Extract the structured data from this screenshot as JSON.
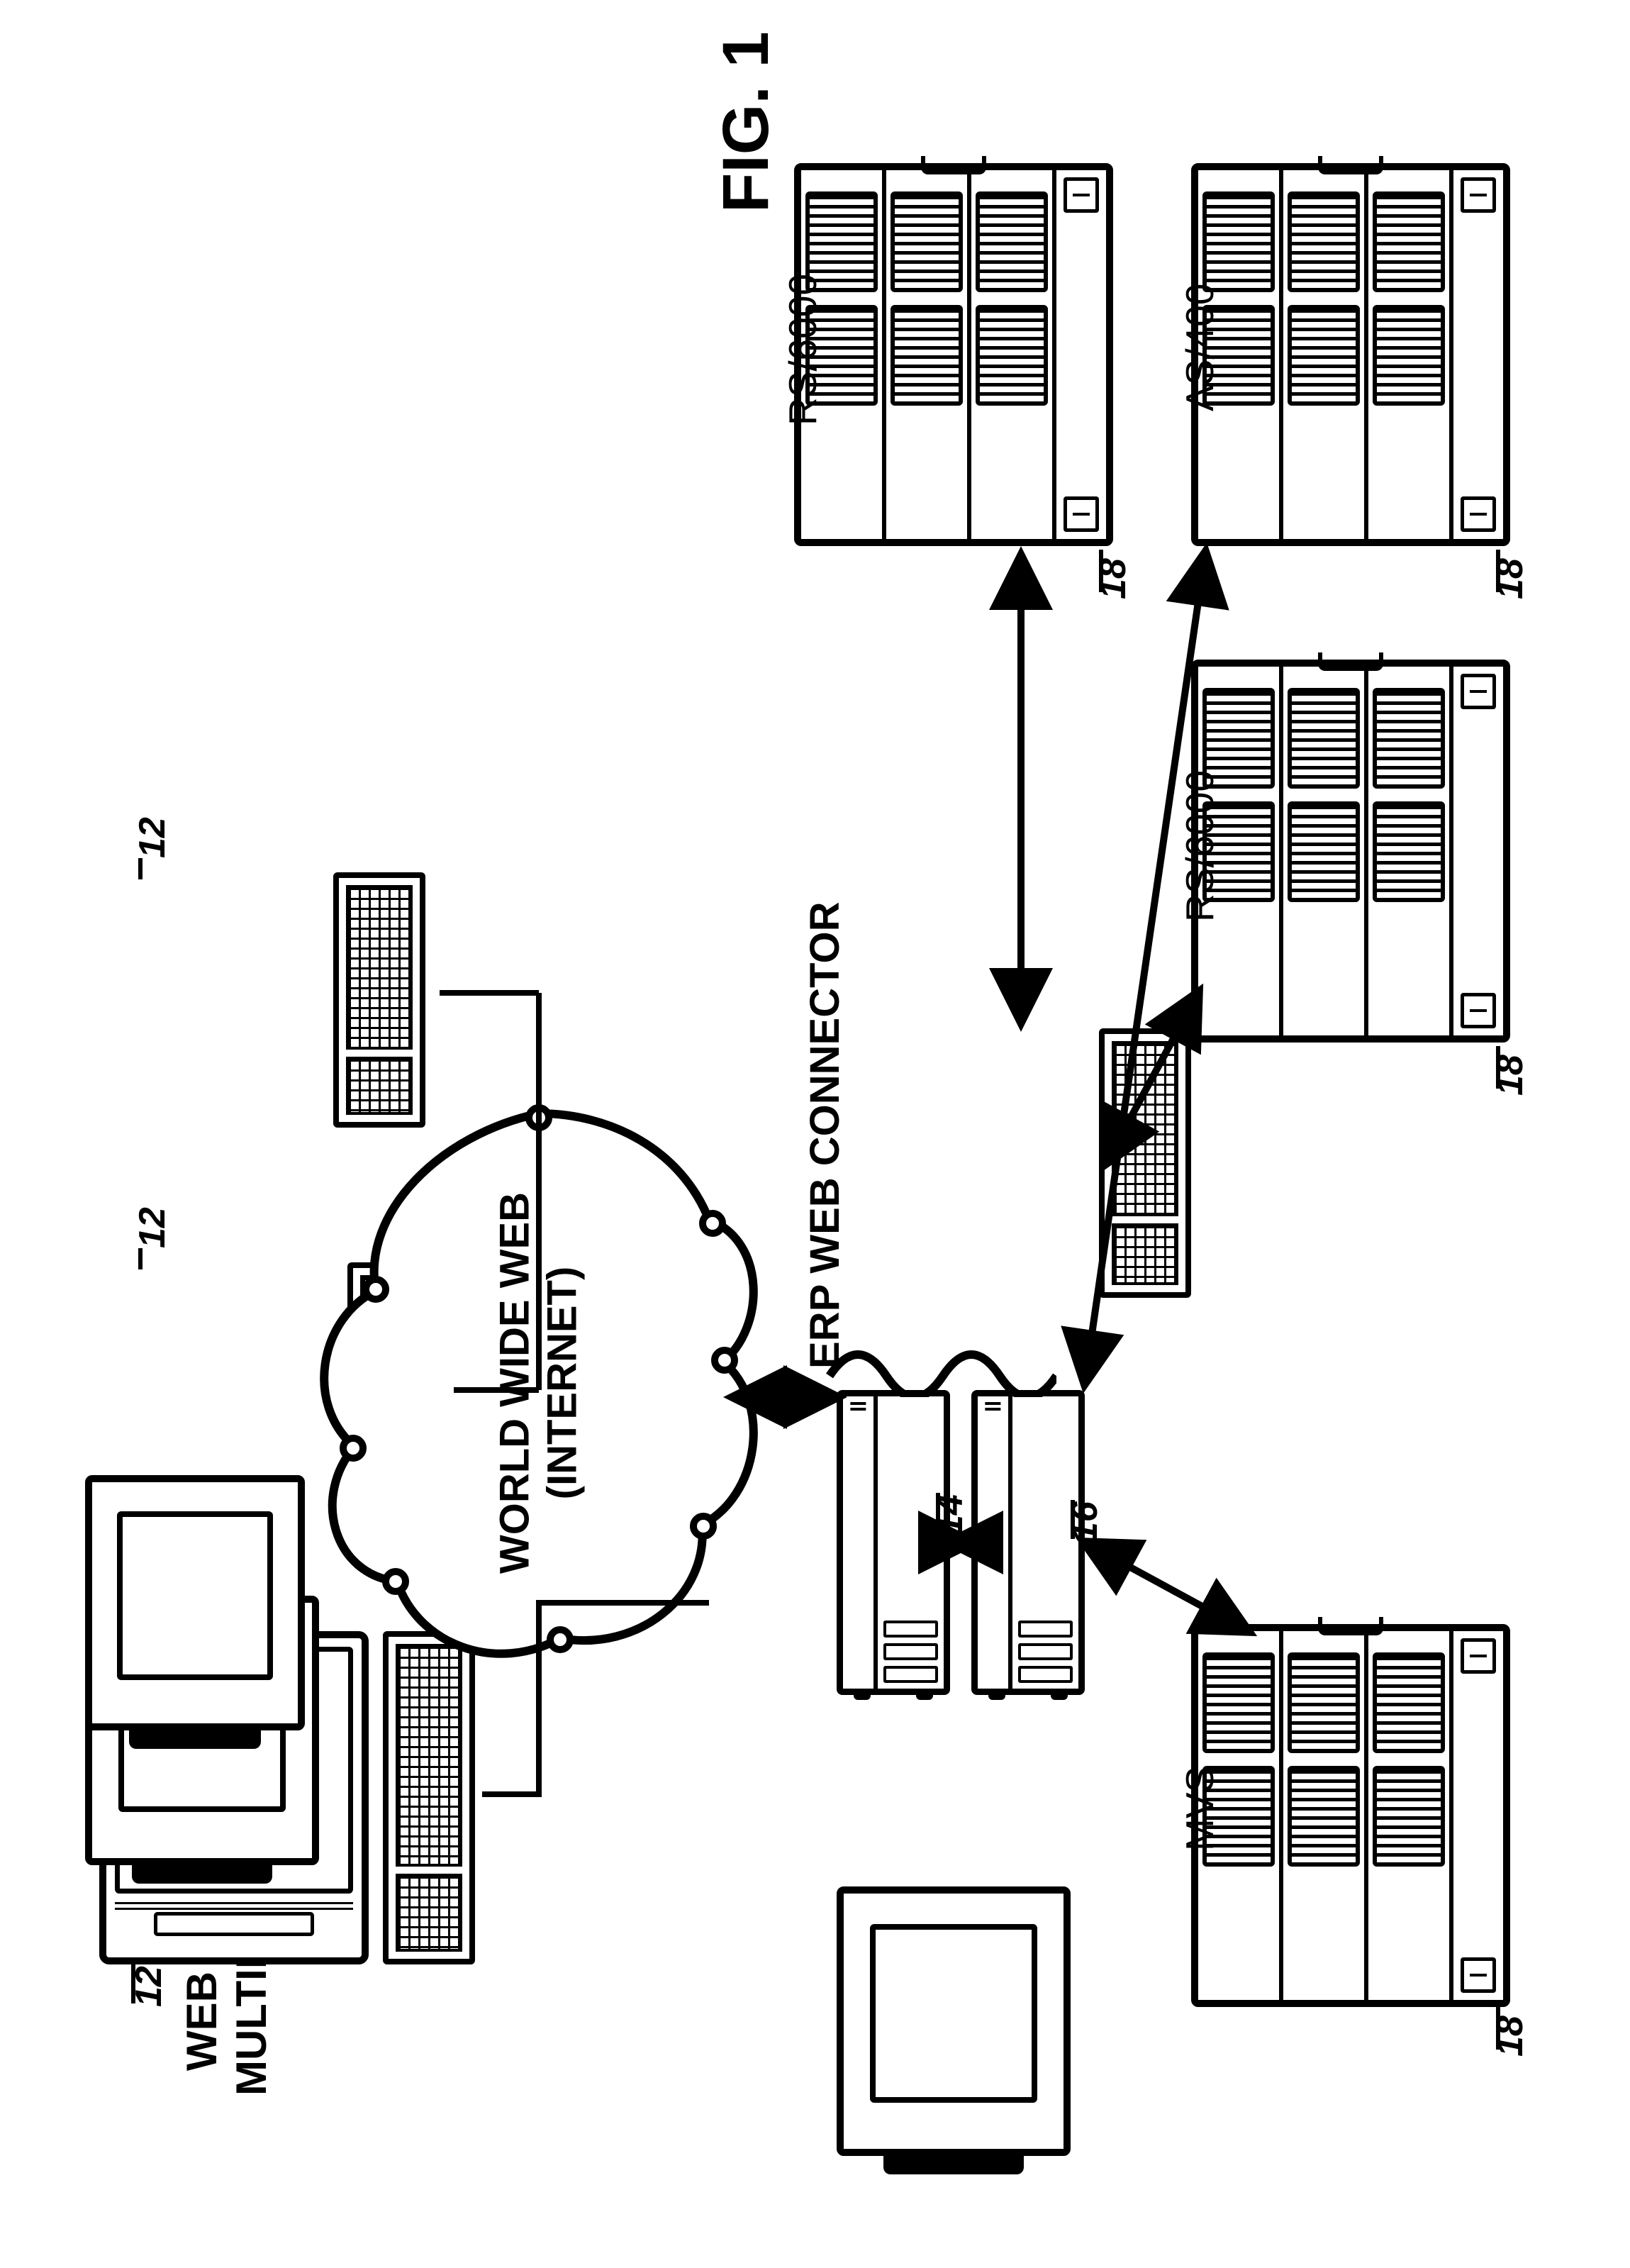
{
  "figure_title": "FIG. 1",
  "labels": {
    "browsers_heading_l1": "WEB BROWSERS ON",
    "browsers_heading_l2": "MULTIPLE PLATFORMS",
    "cloud_l1": "WORLD WIDE WEB",
    "cloud_l2": "(INTERNET)",
    "erp": "ERP WEB CONNECTOR",
    "server_mvs": "MVS",
    "server_as400": "AS/400",
    "server_rs6000_a": "RS/6000",
    "server_rs6000_b": "RS/6000"
  },
  "refs": {
    "browser_a": "12",
    "browser_b": "12",
    "browser_c": "12",
    "web_server": "14",
    "erp_connector": "16",
    "server_mvs": "18",
    "server_as400": "18",
    "server_rs6000_a": "18",
    "server_rs6000_b": "18"
  }
}
